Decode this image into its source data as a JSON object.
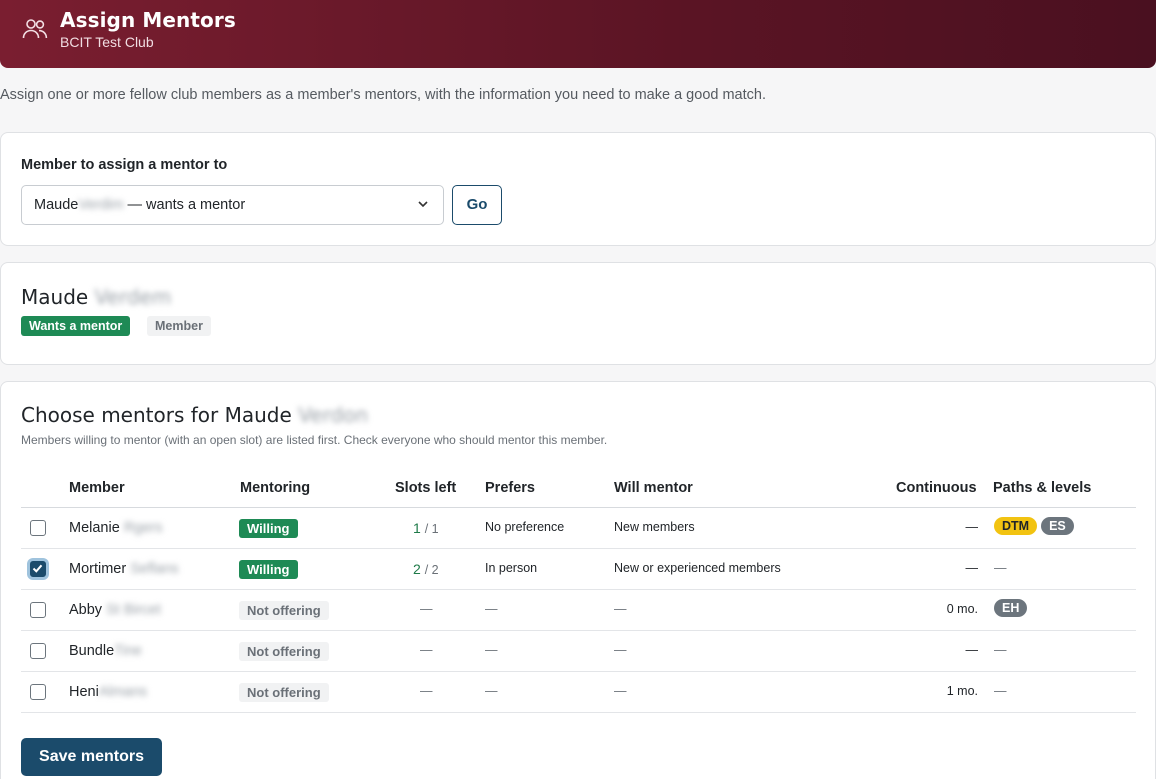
{
  "header": {
    "title": "Assign Mentors",
    "subtitle": "BCIT Test Club",
    "icon": "users-icon"
  },
  "intro": "Assign one or more fellow club members as a member's mentors, with the information you need to make a good match.",
  "selector": {
    "label": "Member to assign a mentor to",
    "selected_first": "Maude",
    "selected_last": "Verdim",
    "selected_suffix": " — wants a mentor",
    "go_label": "Go"
  },
  "member": {
    "first": "Maude",
    "last": "Verdem",
    "status_badge": "Wants a mentor",
    "role_badge": "Member"
  },
  "choose": {
    "title_prefix": "Choose mentors for Maude",
    "title_last": "Verdon",
    "subtitle": "Members willing to mentor (with an open slot) are listed first. Check everyone who should mentor this member.",
    "columns": [
      "Member",
      "Mentoring",
      "Slots left",
      "Prefers",
      "Will mentor",
      "Continuous",
      "Paths & levels"
    ],
    "rows": [
      {
        "checked": false,
        "first": "Melanie",
        "last": "Rgers",
        "mentoring": "Willing",
        "slots_left": "1",
        "slots_total": "/ 1",
        "prefers": "No preference",
        "will_mentor": "New members",
        "continuous": "—",
        "paths": [
          "DTM",
          "ES"
        ]
      },
      {
        "checked": true,
        "first": "Mortimer",
        "last": "Seflans",
        "mentoring": "Willing",
        "slots_left": "2",
        "slots_total": "/ 2",
        "prefers": "In person",
        "will_mentor": "New or experienced members",
        "continuous": "—",
        "paths_text": "—"
      },
      {
        "checked": false,
        "first": "Abby",
        "last": "St Bircet",
        "mentoring": "Not offering",
        "slots_dash": "—",
        "prefers": "—",
        "will_mentor": "—",
        "continuous": "0 mo.",
        "paths": [
          "EH"
        ]
      },
      {
        "checked": false,
        "first": "Bundle",
        "last": "Tine",
        "mentoring": "Not offering",
        "slots_dash": "—",
        "prefers": "—",
        "will_mentor": "—",
        "continuous": "—",
        "paths_text": "—"
      },
      {
        "checked": false,
        "first": "Heni",
        "last": "Almans",
        "mentoring": "Not offering",
        "slots_dash": "—",
        "prefers": "—",
        "will_mentor": "—",
        "continuous": "1 mo.",
        "paths_text": "—"
      }
    ],
    "save_label": "Save mentors"
  },
  "colors": {
    "header": "#6b1a2b",
    "willing": "#1e8a55",
    "primary": "#1b4b6b",
    "dtm": "#f2c311",
    "path_chip": "#6c757d"
  }
}
